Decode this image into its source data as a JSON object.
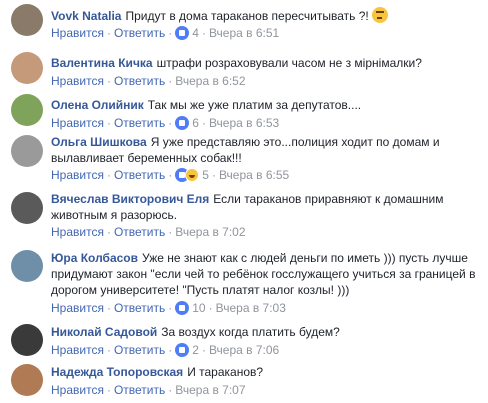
{
  "comments": [
    {
      "author": "Vovk Natalia",
      "text": "Придут в дома тараканов пересчитывать ?!",
      "emoji": "thinking-face-emoji",
      "like": "Нравится",
      "reply": "Ответить",
      "reactions": "4",
      "reaction_types": [
        "like"
      ],
      "time": "Вчера в 6:51",
      "avatar_color": "#8a7a6a"
    },
    {
      "author": "Валентина Кичка",
      "text": "штрафи розраховували часом не з мірнімалки?",
      "like": "Нравится",
      "reply": "Ответить",
      "reactions": "",
      "reaction_types": [],
      "time": "Вчера в 6:52",
      "avatar_color": "#c49a7a"
    },
    {
      "author": "Олена Олийник",
      "text": "Так мы же уже платим за депутатов....",
      "like": "Нравится",
      "reply": "Ответить",
      "reactions": "6",
      "reaction_types": [
        "like"
      ],
      "time": "Вчера в 6:53",
      "avatar_color": "#7fa35a"
    },
    {
      "author": "Ольга Шишкова",
      "text": "Я уже представляю это...полиция ходит по домам и вылавливает беременных собак!!!",
      "like": "Нравится",
      "reply": "Ответить",
      "reactions": "5",
      "reaction_types": [
        "like",
        "haha"
      ],
      "time": "Вчера в 6:55",
      "avatar_color": "#9a9a9a"
    },
    {
      "author": "Вячеслав Викторович Еля",
      "text": "Если тараканов приравняют к домашним животным я разорюсь.",
      "like": "Нравится",
      "reply": "Ответить",
      "reactions": "",
      "reaction_types": [],
      "time": "Вчера в 7:02",
      "avatar_color": "#5a5a5a"
    },
    {
      "author": "Юра Колбасов",
      "text": "Уже не знают как с людей деньги по иметь ))) пусть лучше придумают закон \"если чей то ребёнок госслужащего учиться за границей в дорогом университете! \"Пусть платят налог козлы! )))",
      "like": "Нравится",
      "reply": "Ответить",
      "reactions": "10",
      "reaction_types": [
        "like"
      ],
      "time": "Вчера в 7:03",
      "avatar_color": "#6f8fa8"
    },
    {
      "author": "Николай Садовой",
      "text": "За воздух когда платить будем?",
      "like": "Нравится",
      "reply": "Ответить",
      "reactions": "2",
      "reaction_types": [
        "like"
      ],
      "time": "Вчера в 7:06",
      "avatar_color": "#3a3a3a"
    },
    {
      "author": "Надежда Топоровская",
      "text": "И тараканов?",
      "like": "Нравится",
      "reply": "Ответить",
      "reactions": "",
      "reaction_types": [],
      "time": "Вчера в 7:07",
      "avatar_color": "#b07a55"
    }
  ]
}
